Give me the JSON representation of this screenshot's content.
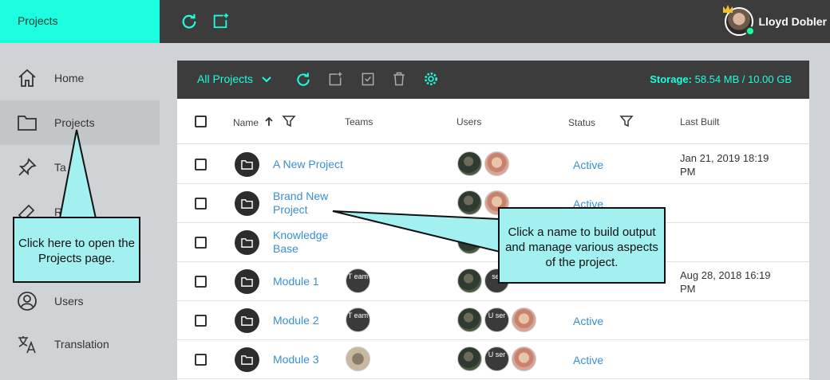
{
  "header": {
    "app_name": "Projects",
    "user_name": "Lloyd Dobler",
    "icons": [
      "refresh-icon",
      "add-project-icon"
    ]
  },
  "sidebar": {
    "items": [
      {
        "label": "Home",
        "icon": "home-icon"
      },
      {
        "label": "Projects",
        "icon": "folder-icon"
      },
      {
        "label": "Ta",
        "icon": "pin-icon"
      },
      {
        "label": "R",
        "icon": "eraser-icon"
      },
      {
        "label": "",
        "icon": "user-icon"
      },
      {
        "label": "Users",
        "icon": "user-icon"
      },
      {
        "label": "Translation",
        "icon": "translate-icon"
      }
    ]
  },
  "toolbar": {
    "filter_label": "All Projects",
    "storage_label": "Storage:",
    "storage_value": "58.54 MB / 10.00 GB"
  },
  "table": {
    "headers": {
      "name": "Name",
      "teams": "Teams",
      "users": "Users",
      "status": "Status",
      "last_built": "Last Built"
    },
    "rows": [
      {
        "name_line1": "A New Project",
        "name_line2": "",
        "status": "Active",
        "built_line1": "Jan 21, 2019 18:19",
        "built_line2": "PM",
        "team": "",
        "users": [
          "u1",
          "u2"
        ]
      },
      {
        "name_line1": "Brand New",
        "name_line2": "Project",
        "status": "Active",
        "built_line1": "",
        "built_line2": "",
        "team": "",
        "users": [
          "u1",
          "u2"
        ]
      },
      {
        "name_line1": "Knowledge",
        "name_line2": "Base",
        "status": "",
        "built_line1": "",
        "built_line2": "",
        "team": "",
        "users": [
          "u1"
        ]
      },
      {
        "name_line1": "Module 1",
        "name_line2": "",
        "status": "",
        "built_line1": "Aug 28, 2018 16:19",
        "built_line2": "PM",
        "team": "T eam",
        "users": [
          "u1",
          "ser"
        ]
      },
      {
        "name_line1": "Module 2",
        "name_line2": "",
        "status": "Active",
        "built_line1": "",
        "built_line2": "",
        "team": "T eam",
        "users": [
          "u1",
          "U ser",
          "u2"
        ]
      },
      {
        "name_line1": "Module 3",
        "name_line2": "",
        "status": "Active",
        "built_line1": "",
        "built_line2": "",
        "team": "rhino",
        "users": [
          "u1",
          "U ser",
          "u2"
        ]
      }
    ]
  },
  "callouts": {
    "projects_nav": "Click here to open the Projects page.",
    "project_name": "Click a name to build output and manage various aspects of the project."
  },
  "colors": {
    "accent": "#1dfde0",
    "topbar": "#3c3c3c",
    "link": "#3a8fd0",
    "callout": "#a2f0ef"
  }
}
